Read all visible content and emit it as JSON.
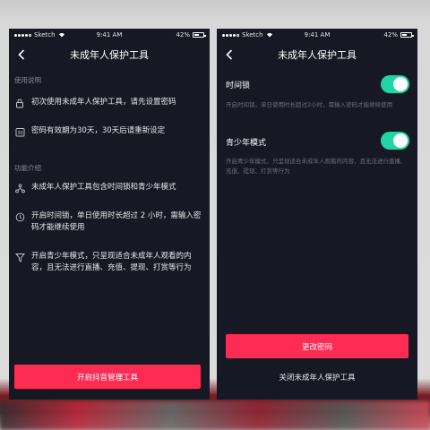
{
  "status_bar": {
    "carrier": "Sketch",
    "time": "9:41 AM",
    "battery": "42%"
  },
  "screen_left": {
    "title": "未成年人保护工具",
    "sections": [
      {
        "label": "使用说明",
        "items": [
          {
            "icon": "lock-icon",
            "text": "初次使用未成年人保护工具，请先设置密码"
          },
          {
            "icon": "calendar-30-icon",
            "text": "密码有效期为30天，30天后请重新设定"
          }
        ]
      },
      {
        "label": "功能介绍",
        "items": [
          {
            "icon": "network-icon",
            "text": "未成年人保护工具包含时间锁和青少年模式"
          },
          {
            "icon": "clock-icon",
            "text": "开启时间锁，单日使用时长超过 2 小时，需输入密码才能继续使用"
          },
          {
            "icon": "filter-icon",
            "text": "开启青少年模式，只呈现适合未成年人观看的内容，且无法进行直播、充值、提现、打赏等行为"
          }
        ]
      }
    ],
    "enable_button_label": "开启抖音管理工具"
  },
  "screen_right": {
    "title": "未成年人保护工具",
    "settings": [
      {
        "label": "时间锁",
        "description": "开启时间锁，单日使用时长超过2小时，需输入密码才能继续使用",
        "enabled": true
      },
      {
        "label": "青少年模式",
        "description": "开启青少年模式，只呈现适合未成年人观看的内容，且无法进行直播、充值、提现、打赏等行为",
        "enabled": true
      }
    ],
    "change_password_label": "更改密码",
    "close_tool_label": "关闭未成年人保护工具"
  },
  "colors": {
    "background": "#161823",
    "accent": "#fe2c55",
    "toggle_on": "#20d5a4"
  }
}
